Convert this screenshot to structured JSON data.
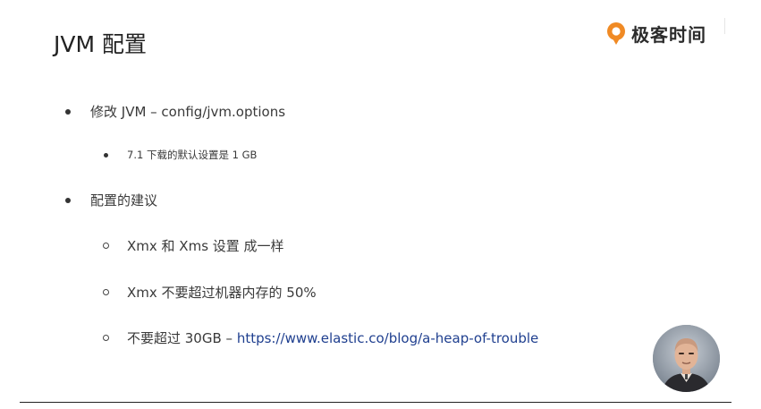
{
  "slide": {
    "title": "JVM 配置"
  },
  "brand": {
    "name": "极客时间",
    "icon": "geektime-logo-icon",
    "accent_color": "#f08a24"
  },
  "content": {
    "items": [
      {
        "level": 1,
        "marker": "disc",
        "text": "修改 JVM – config/jvm.options"
      },
      {
        "level": 2,
        "marker": "disc",
        "text": "7.1 下载的默认设置是 1 GB"
      },
      {
        "level": 1,
        "marker": "disc",
        "text": "配置的建议"
      },
      {
        "level": 2,
        "marker": "ring",
        "text": "Xmx 和 Xms 设置 成一样"
      },
      {
        "level": 2,
        "marker": "ring",
        "text": "Xmx 不要超过机器内存的 50%"
      },
      {
        "level": 2,
        "marker": "ring",
        "text_prefix": "不要超过 30GB – ",
        "link_text": "https://www.elastic.co/blog/a-heap-of-trouble",
        "link_color": "#1f3f8f"
      }
    ]
  },
  "presenter": {
    "avatar_icon": "presenter-avatar"
  }
}
